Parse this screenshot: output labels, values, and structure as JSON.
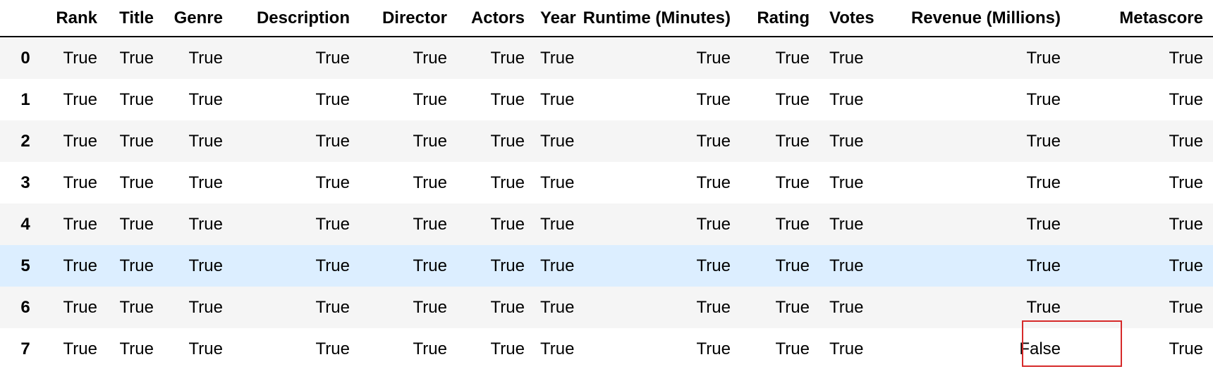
{
  "table": {
    "columns": [
      {
        "key": "index",
        "label": ""
      },
      {
        "key": "rank",
        "label": "Rank"
      },
      {
        "key": "title",
        "label": "Title"
      },
      {
        "key": "genre",
        "label": "Genre"
      },
      {
        "key": "description",
        "label": "Description"
      },
      {
        "key": "director",
        "label": "Director"
      },
      {
        "key": "actors",
        "label": "Actors"
      },
      {
        "key": "year",
        "label": "Year"
      },
      {
        "key": "runtime",
        "label": "Runtime (Minutes)"
      },
      {
        "key": "rating",
        "label": "Rating"
      },
      {
        "key": "votes",
        "label": "Votes"
      },
      {
        "key": "revenue",
        "label": "Revenue (Millions)"
      },
      {
        "key": "metascore",
        "label": "Metascore"
      }
    ],
    "rows": [
      {
        "index": "0",
        "cells": [
          "True",
          "True",
          "True",
          "True",
          "True",
          "True",
          "True",
          "True",
          "True",
          "True",
          "True",
          "True"
        ]
      },
      {
        "index": "1",
        "cells": [
          "True",
          "True",
          "True",
          "True",
          "True",
          "True",
          "True",
          "True",
          "True",
          "True",
          "True",
          "True"
        ]
      },
      {
        "index": "2",
        "cells": [
          "True",
          "True",
          "True",
          "True",
          "True",
          "True",
          "True",
          "True",
          "True",
          "True",
          "True",
          "True"
        ]
      },
      {
        "index": "3",
        "cells": [
          "True",
          "True",
          "True",
          "True",
          "True",
          "True",
          "True",
          "True",
          "True",
          "True",
          "True",
          "True"
        ]
      },
      {
        "index": "4",
        "cells": [
          "True",
          "True",
          "True",
          "True",
          "True",
          "True",
          "True",
          "True",
          "True",
          "True",
          "True",
          "True"
        ]
      },
      {
        "index": "5",
        "cells": [
          "True",
          "True",
          "True",
          "True",
          "True",
          "True",
          "True",
          "True",
          "True",
          "True",
          "True",
          "True"
        ]
      },
      {
        "index": "6",
        "cells": [
          "True",
          "True",
          "True",
          "True",
          "True",
          "True",
          "True",
          "True",
          "True",
          "True",
          "True",
          "True"
        ]
      },
      {
        "index": "7",
        "cells": [
          "True",
          "True",
          "True",
          "True",
          "True",
          "True",
          "True",
          "True",
          "True",
          "True",
          "False",
          "True"
        ]
      }
    ],
    "hovered_row": 5,
    "highlighted_cell": {
      "row": 7,
      "column": "revenue"
    }
  },
  "colors": {
    "row_stripe": "#f5f5f5",
    "row_hover": "#dceeff",
    "highlight_border": "#d62a2a"
  }
}
